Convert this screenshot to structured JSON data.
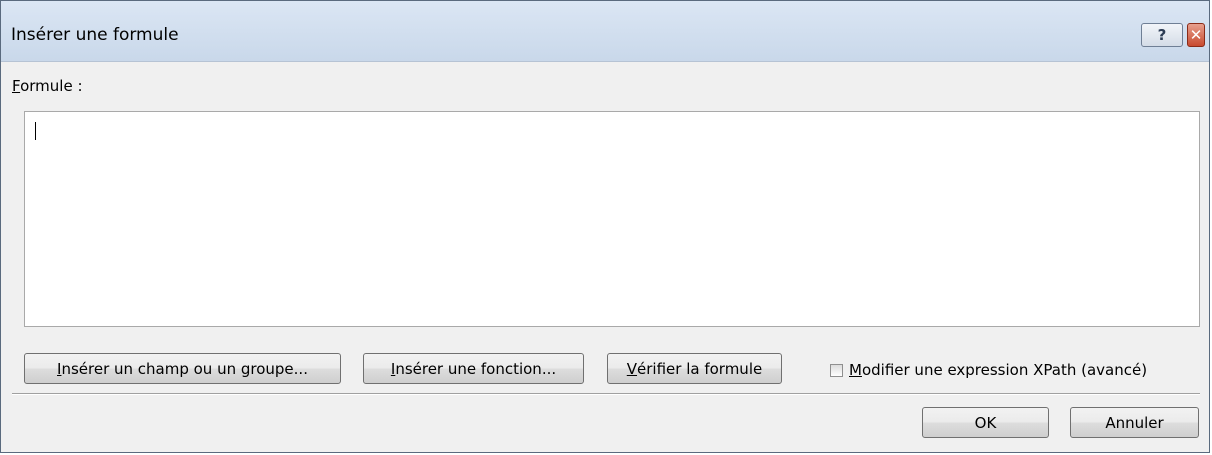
{
  "window": {
    "title": "Insérer une formule",
    "help_glyph": "?",
    "close_glyph": "✕"
  },
  "formula": {
    "label_mnemonic": "F",
    "label_rest": "ormule :",
    "value": ""
  },
  "buttons": {
    "insert_field": {
      "mnemonic": "I",
      "rest": "nsérer un champ ou un groupe..."
    },
    "insert_function": {
      "mnemonic": "I",
      "rest": "nsérer une fonction..."
    },
    "verify": {
      "mnemonic": "V",
      "rest": "érifier la formule"
    },
    "ok": "OK",
    "cancel": "Annuler"
  },
  "xpath_option": {
    "mnemonic": "M",
    "rest": "odifier une expression XPath (avancé)",
    "checked": false
  },
  "colors": {
    "titlebar": "#c9d8ea",
    "dialog_bg": "#f0f0f0",
    "close_button": "#c84a2f"
  }
}
